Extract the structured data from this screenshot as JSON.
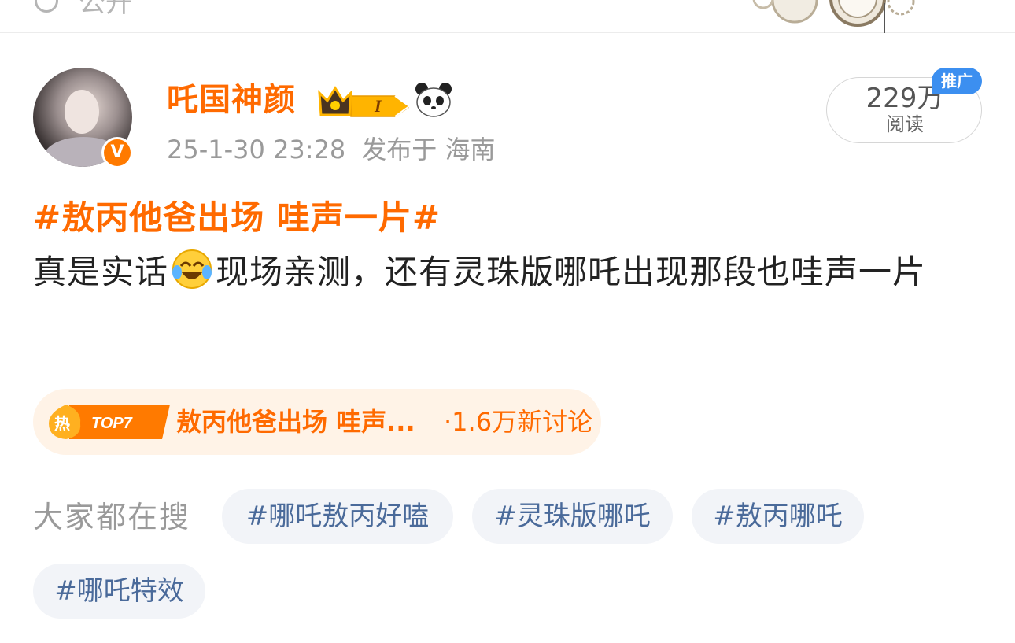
{
  "top_bar": {
    "visibility_label": "公开"
  },
  "post": {
    "author": {
      "name": "吒国神颜",
      "verified": true,
      "verified_badge": "V",
      "level_badge": "I",
      "icons": [
        "crown-icon",
        "panda-icon"
      ]
    },
    "timestamp": "25-1-30 23:28",
    "location": "发布于 海南",
    "reads": {
      "count": "229万",
      "label": "阅读"
    },
    "promo_badge": "推广",
    "topic": "#敖丙他爸出场 哇声一片#",
    "body_before_emoji": "真是实话",
    "body_emoji": "laugh-cry-emoji",
    "body_after_emoji": "现场亲测，还有灵珠版哪吒出现那段也哇声一片"
  },
  "hot_topic": {
    "badge_icon_label": "热",
    "rank_label": "TOP7",
    "title": "敖丙他爸出场 哇声...",
    "discussion": "·1.6万新讨论"
  },
  "searches": {
    "label": "大家都在搜",
    "tags": [
      "#哪吒敖丙好嗑",
      "#灵珠版哪吒",
      "#敖丙哪吒",
      "#哪吒特效"
    ]
  },
  "colors": {
    "accent_orange": "#ff6a00",
    "tag_text_blue": "#4a6a9a",
    "promo_blue": "#3c8ff0",
    "hot_bg": "#fff3e7"
  }
}
